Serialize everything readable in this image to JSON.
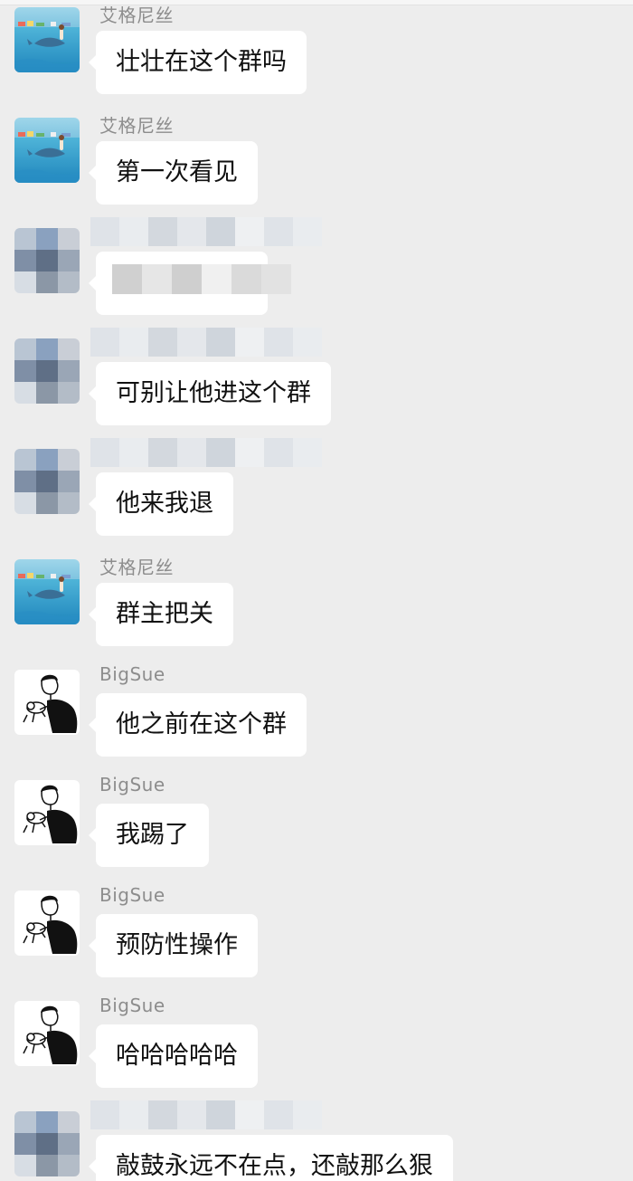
{
  "messages": [
    {
      "sender": "艾格尼丝",
      "text": "壮壮在这个群吗",
      "avatar": "ocean-avatar",
      "redacted": false
    },
    {
      "sender": "艾格尼丝",
      "text": "第一次看见",
      "avatar": "ocean-avatar",
      "redacted": false
    },
    {
      "sender": "",
      "text": "",
      "avatar": "pixelated-avatar",
      "redacted": true
    },
    {
      "sender": "",
      "text": "可别让他进这个群",
      "avatar": "pixelated-avatar",
      "redacted": true
    },
    {
      "sender": "",
      "text": "他来我退",
      "avatar": "pixelated-avatar",
      "redacted": true
    },
    {
      "sender": "艾格尼丝",
      "text": "群主把关",
      "avatar": "ocean-avatar",
      "redacted": false
    },
    {
      "sender": "BigSue",
      "text": "他之前在这个群",
      "avatar": "man-with-dog-avatar",
      "redacted": false
    },
    {
      "sender": "BigSue",
      "text": "我踢了",
      "avatar": "man-with-dog-avatar",
      "redacted": false
    },
    {
      "sender": "BigSue",
      "text": "预防性操作",
      "avatar": "man-with-dog-avatar",
      "redacted": false
    },
    {
      "sender": "BigSue",
      "text": "哈哈哈哈哈",
      "avatar": "man-with-dog-avatar",
      "redacted": false
    },
    {
      "sender": "",
      "text": "敲鼓永远不在点，还敲那么狠",
      "avatar": "pixelated-avatar",
      "redacted": true
    }
  ],
  "colors": {
    "background": "#ededed",
    "bubble": "#ffffff",
    "sender": "#8d8d8d",
    "text": "#111111"
  }
}
